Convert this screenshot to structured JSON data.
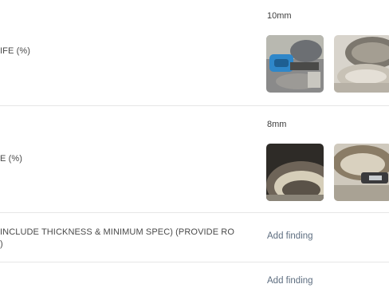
{
  "rows": [
    {
      "label": "IFE (%)",
      "value": "10mm",
      "photos": [
        "brake-photo-1",
        "brake-photo-2"
      ]
    },
    {
      "label": "E (%)",
      "value": "8mm",
      "photos": [
        "rotor-photo-1",
        "rotor-photo-2"
      ]
    },
    {
      "label": "INCLUDE THICKNESS & MINIMUM SPEC) (PROVIDE RO\n)",
      "action": "Add finding"
    },
    {
      "label": "",
      "action": "Add finding"
    }
  ],
  "colors": {
    "divider": "#e6e6e6",
    "link": "#5e6e80",
    "text": "#3c3c3c"
  }
}
